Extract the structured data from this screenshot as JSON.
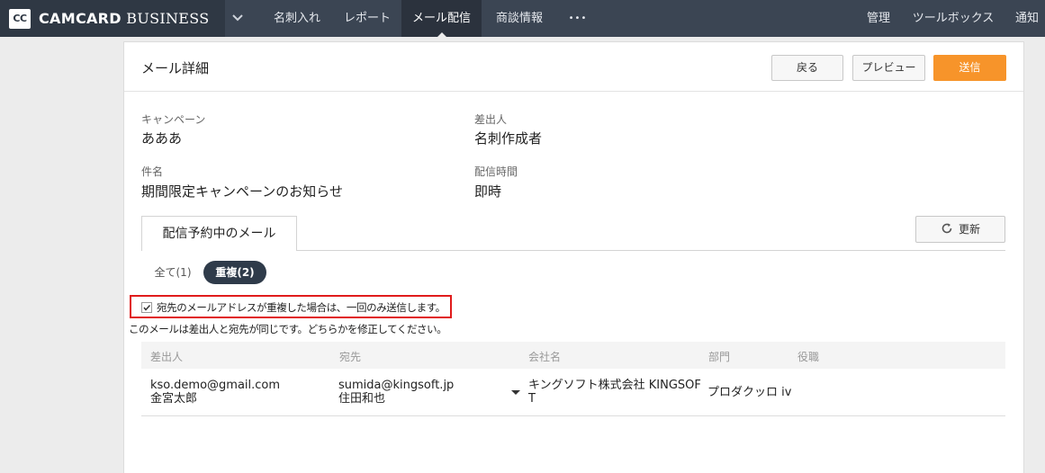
{
  "brand": {
    "logo": "CC",
    "name_bold": "CAMCARD",
    "name_rest": " BUSINESS"
  },
  "nav": {
    "items": [
      "名刺入れ",
      "レポート",
      "メール配信",
      "商談情報"
    ],
    "more": "•••",
    "right": [
      "管理",
      "ツールボックス",
      "通知"
    ],
    "active_index": 2
  },
  "page": {
    "title": "メール詳細",
    "back": "戻る",
    "preview": "プレビュー",
    "send": "送信"
  },
  "fields": {
    "campaign_label": "キャンペーン",
    "campaign_value": "あああ",
    "sender_label": "差出人",
    "sender_value": "名刺作成者",
    "subject_label": "件名",
    "subject_value": "期間限定キャンペーンのお知らせ",
    "time_label": "配信時間",
    "time_value": "即時"
  },
  "tab": {
    "label": "配信予約中のメール",
    "refresh": "更新"
  },
  "filters": {
    "all": "全て(1)",
    "dup": "重複(2)"
  },
  "dedupe": {
    "checked": true,
    "label": "宛先のメールアドレスが重複した場合は、一回のみ送信します。",
    "warning": "このメールは差出人と宛先が同じです。どちらかを修正してください。"
  },
  "table": {
    "headers": [
      "差出人",
      "宛先",
      "会社名",
      "部門",
      "役職"
    ],
    "rows": [
      {
        "sender_email": "kso.demo@gmail.com",
        "sender_name": "金宮太郎",
        "to_email": "sumida@kingsoft.jp",
        "to_name": "住田和也",
        "company_1": "キングソフト株式会社 KINGSOF",
        "company_2": "T",
        "department": "プロダクッロ iv",
        "title": ""
      }
    ]
  },
  "colors": {
    "nav_bg": "#3b4553",
    "accent": "#f7942a",
    "highlight_border": "#e01b1b"
  }
}
